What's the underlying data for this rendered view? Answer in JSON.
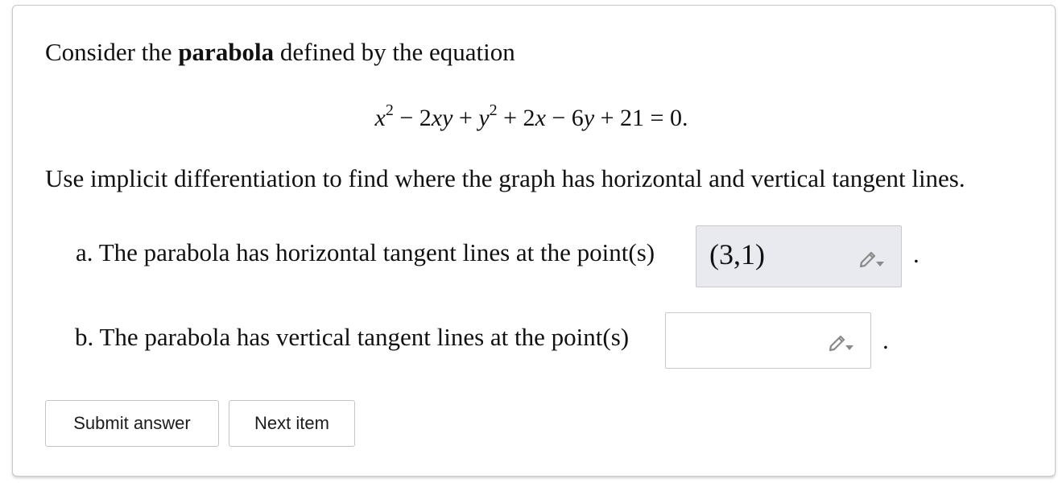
{
  "question": {
    "intro_before": "Consider the ",
    "intro_bold": "parabola",
    "intro_after": " defined by the equation",
    "equation": {
      "t1": "x",
      "e1": "2",
      "t2": " − 2",
      "t3": "xy",
      "t4": " + ",
      "t5": "y",
      "e2": "2",
      "t6": " + 2",
      "t7": "x",
      "t8": " − 6",
      "t9": "y",
      "t10": " + 21 = 0."
    },
    "instruction": "Use implicit differentiation to find where the graph has horizontal and vertical tangent lines."
  },
  "parts": {
    "a": {
      "label": "a. The parabola has horizontal tangent lines at the point(s)",
      "answer": "(3,1)",
      "suffix": "."
    },
    "b": {
      "label": "b. The parabola has vertical tangent lines at the point(s)",
      "answer": "",
      "suffix": "."
    }
  },
  "buttons": {
    "submit": "Submit answer",
    "next": "Next item"
  },
  "icons": {
    "answer_edit": "pencil-dropdown-icon"
  },
  "colors": {
    "filled_answer_bg": "#e9eaef",
    "border": "#c9c9c9",
    "icon": "#8a8a8a"
  }
}
